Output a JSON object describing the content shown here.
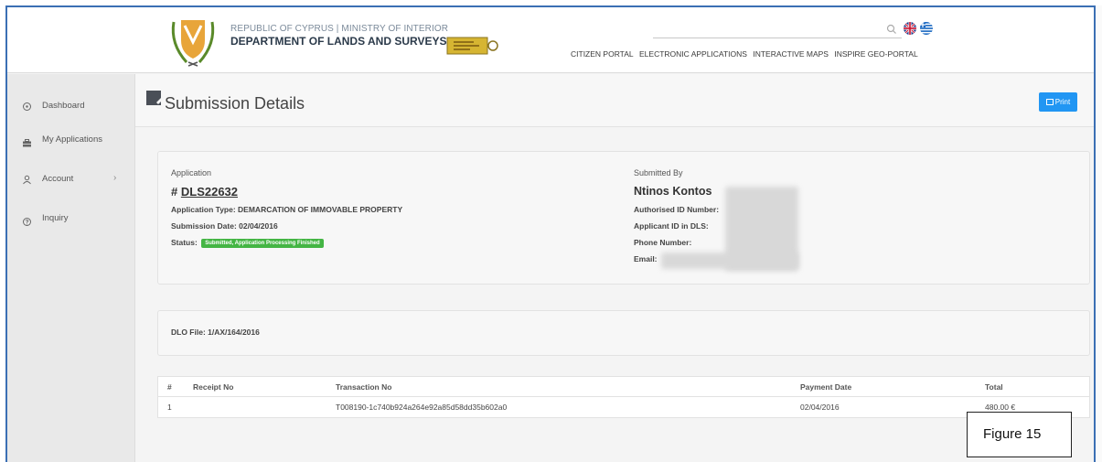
{
  "header": {
    "brand_small": "REPUBLIC OF CYPRUS | MINISTRY OF INTERIOR",
    "brand_big": "DEPARTMENT OF LANDS AND SURVEYS",
    "nav": [
      "CITIZEN PORTAL",
      "ELECTRONIC APPLICATIONS",
      "INTERACTIVE MAPS",
      "INSPIRE GEO-PORTAL"
    ],
    "icons": {
      "search": "search-icon",
      "lang_en": "uk-flag-icon",
      "lang_gr": "greek-flag-icon",
      "crest": "cyprus-crest-logo",
      "dls": "dls-logo"
    }
  },
  "sidebar": {
    "items": [
      {
        "label": "Dashboard",
        "icon": "dashboard-icon"
      },
      {
        "label": "My Applications",
        "icon": "briefcase-icon"
      },
      {
        "label": "Account",
        "icon": "user-icon",
        "chevron": "›"
      },
      {
        "label": "Inquiry",
        "icon": "question-icon"
      }
    ]
  },
  "page": {
    "title": "Submission Details",
    "print_label": "Print"
  },
  "application": {
    "section_label": "Application",
    "number_prefix": "#",
    "number": "DLS22632",
    "type": "Application Type: DEMARCATION OF IMMOVABLE PROPERTY",
    "submission_date": "Submission Date: 02/04/2016",
    "status_label": "Status:",
    "status_value": "Submitted, Application Processing Finished"
  },
  "submitted_by": {
    "section_label": "Submitted By",
    "name": "Ntinos Kontos",
    "authorised_id": "Authorised ID Number:",
    "applicant_id": "Applicant ID in DLS:",
    "phone": "Phone Number:",
    "email": "Email:"
  },
  "dlo": {
    "file": "DLO File: 1/AX/164/2016"
  },
  "payments": {
    "headers": [
      "#",
      "Receipt No",
      "Transaction No",
      "Payment Date",
      "Total"
    ],
    "rows": [
      [
        "1",
        "",
        "T008190-1c740b924a264e92a85d58dd35b602a0",
        "02/04/2016",
        "480.00 €"
      ]
    ]
  },
  "figure_label": "Figure 15",
  "colors": {
    "accent": "#2196f3",
    "status": "#44b544",
    "frame": "#3b6fb4"
  }
}
